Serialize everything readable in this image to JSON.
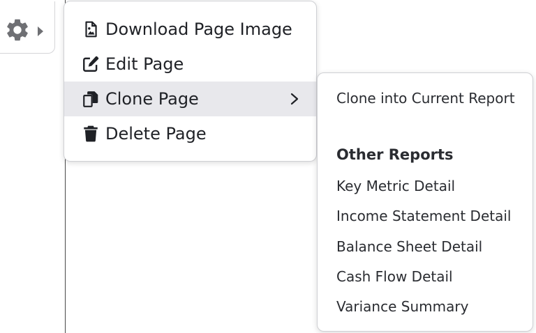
{
  "sidebar": {
    "gear_icon": "gear-icon",
    "caret_icon": "caret-right-icon"
  },
  "menu": {
    "items": [
      {
        "label": "Download Page Image",
        "icon": "image-file-icon"
      },
      {
        "label": "Edit Page",
        "icon": "edit-icon"
      },
      {
        "label": "Clone Page",
        "icon": "copy-icon",
        "has_submenu": true,
        "active": true
      },
      {
        "label": "Delete Page",
        "icon": "trash-icon"
      }
    ]
  },
  "submenu": {
    "clone_current": "Clone into Current Report",
    "heading": "Other Reports",
    "reports": [
      "Key Metric Detail",
      "Income Statement Detail",
      "Balance Sheet Detail",
      "Cash Flow Detail",
      "Variance Summary"
    ]
  },
  "colors": {
    "text": "#1f2126",
    "active_bg": "#e8e8ec",
    "border": "#cfd0d4",
    "icon": "#6f7074"
  }
}
